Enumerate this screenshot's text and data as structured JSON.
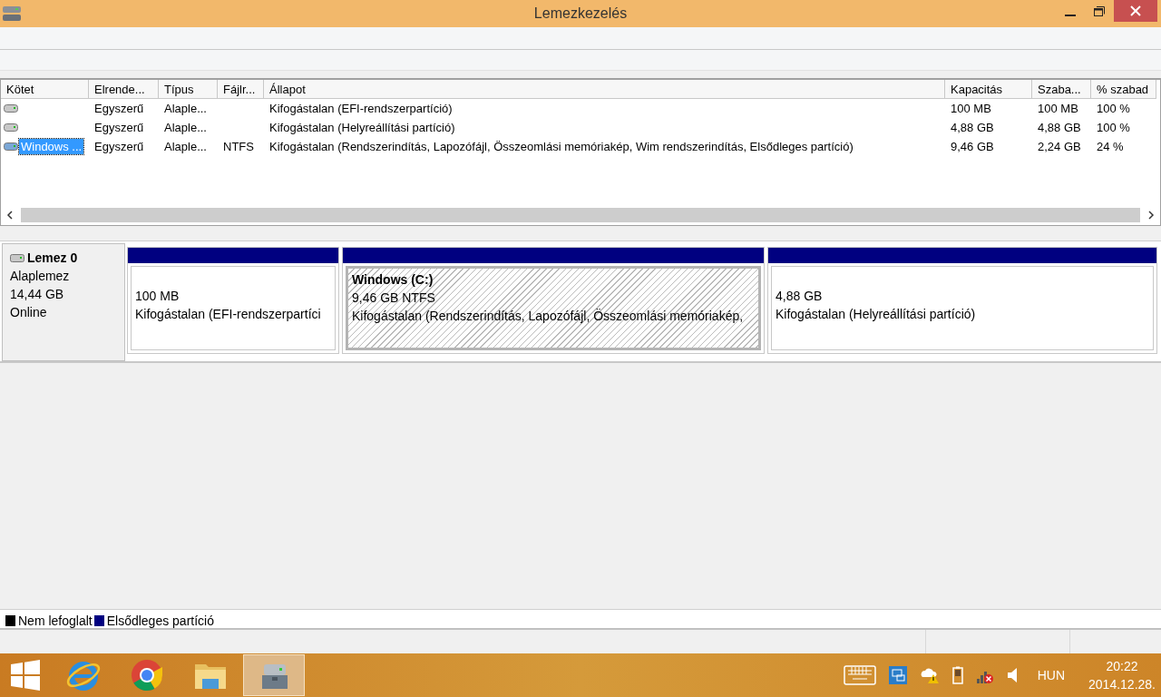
{
  "window": {
    "title": "Lemezkezelés"
  },
  "table": {
    "columns": [
      "Kötet",
      "Elrende...",
      "Típus",
      "Fájlr...",
      "Állapot",
      "Kapacitás",
      "Szaba...",
      "% szabad"
    ],
    "rows": [
      {
        "layout": "Egyszerű",
        "type": "Alaple...",
        "status": "Kifogástalan (EFI-rendszerpartíció)",
        "capacity": "100 MB",
        "free": "100 MB",
        "percent": "100 %",
        "selected": false
      },
      {
        "layout": "Egyszerű",
        "type": "Alaple...",
        "status": "Kifogástalan (Helyreállítási partíció)",
        "capacity": "4,88 GB",
        "free": "4,88 GB",
        "percent": "100 %",
        "selected": false
      },
      {
        "volume": "Windows ...",
        "layout": "Egyszerű",
        "type": "Alaple...",
        "filesystem": "NTFS",
        "status": "Kifogástalan (Rendszerindítás, Lapozófájl, Összeomlási memóriakép, Wim rendszerindítás, Elsődleges partíció)",
        "capacity": "9,46 GB",
        "free": "2,24 GB",
        "percent": "24 %",
        "selected": true
      }
    ]
  },
  "disk": {
    "name": "Lemez 0",
    "type": "Alaplemez",
    "size": "14,44 GB",
    "state": "Online",
    "partitions": [
      {
        "size": "100 MB",
        "status": "Kifogástalan (EFI-rendszerpartíci",
        "selected": false
      },
      {
        "label": "Windows  (C:)",
        "size": "9,46 GB NTFS",
        "status": "Kifogástalan (Rendszerindítás, Lapozófájl, Összeomlási memóriakép,",
        "selected": true
      },
      {
        "size": "4,88 GB",
        "status": "Kifogástalan (Helyreállítási partíció)",
        "selected": false
      }
    ]
  },
  "legend": [
    {
      "label": "Nem lefoglalt",
      "color": "#000000"
    },
    {
      "label": "Elsődleges partíció",
      "color": "#000080"
    }
  ],
  "taskbar": {
    "apps": [
      {
        "kind": "ie",
        "selected": false
      },
      {
        "kind": "chrome",
        "selected": false
      },
      {
        "kind": "folder",
        "selected": false
      },
      {
        "kind": "disk",
        "selected": true
      }
    ],
    "language": "HUN",
    "time": "20:22",
    "date": "2014.12.28."
  }
}
